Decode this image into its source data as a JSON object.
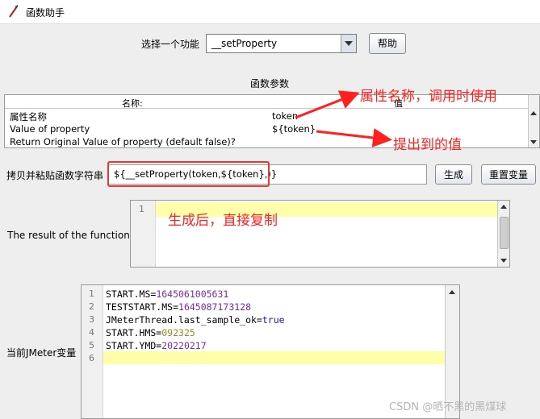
{
  "window": {
    "title": "函数助手",
    "icon": "feather-pen-icon"
  },
  "function_row": {
    "label": "选择一个功能",
    "selected": "__setProperty",
    "help_label": "帮助"
  },
  "params": {
    "heading": "函数参数",
    "column_name": "名称:",
    "column_value": "值",
    "rows": [
      {
        "name": "属性名称",
        "value": "token"
      },
      {
        "name": "Value of property",
        "value": "${token}"
      },
      {
        "name": "Return Original Value of property (default false)?",
        "value": ""
      }
    ]
  },
  "copy_row": {
    "label": "拷贝并粘贴函数字符串",
    "value": "${__setProperty(token,${token},)}",
    "generate_label": "生成",
    "reset_label": "重置变量"
  },
  "result": {
    "label": "The result of the function is",
    "line_number": "1"
  },
  "vars": {
    "label": "当前JMeter变量",
    "lines": [
      {
        "num": "1",
        "key": "START.MS=",
        "val": "1645061005631"
      },
      {
        "num": "2",
        "key": "TESTSTART.MS=",
        "val": "1645087173128"
      },
      {
        "num": "3",
        "key": "JMeterThread.last_sample_ok=",
        "val": "true"
      },
      {
        "num": "4",
        "key": "START.HMS=",
        "val": "092325"
      },
      {
        "num": "5",
        "key": "START.YMD=",
        "val": "20220217"
      },
      {
        "num": "6",
        "key": "",
        "val": ""
      }
    ]
  },
  "annotations": {
    "property_name": "属性名称，调用时使用",
    "extracted_value": "提出到的值",
    "copy_after": "生成后，直接复制"
  },
  "colors": {
    "annotation": "#ff2020",
    "highlight": "#ffffaa",
    "number": "#7b2aa6"
  },
  "watermark": "CSDN @晒不黑的黑煤球"
}
